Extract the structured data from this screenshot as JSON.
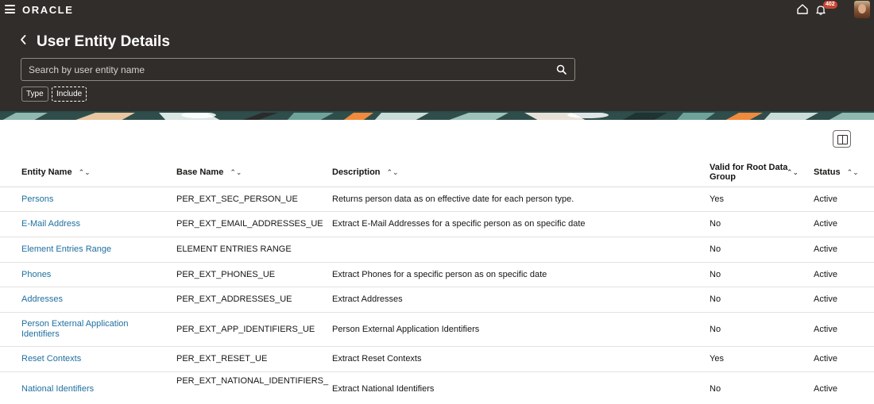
{
  "topbar": {
    "brand": "ORACLE",
    "notification_count": "402"
  },
  "header": {
    "title": "User Entity Details"
  },
  "search": {
    "placeholder": "Search by user entity name",
    "value": ""
  },
  "filters": {
    "type_label": "Type",
    "include_label": "Include"
  },
  "table": {
    "columns": [
      "Entity Name",
      "Base Name",
      "Description",
      "Valid for Root Data Group",
      "Status"
    ],
    "rows": [
      {
        "entity": "Persons",
        "base": "PER_EXT_SEC_PERSON_UE",
        "description": "Returns person data as on effective date for each person type.",
        "valid_root": "Yes",
        "status": "Active"
      },
      {
        "entity": "E-Mail Address",
        "base": "PER_EXT_EMAIL_ADDRESSES_UE",
        "description": "Extract E-Mail Addresses for a specific person as on specific date",
        "valid_root": "No",
        "status": "Active"
      },
      {
        "entity": "Element Entries Range",
        "base": "ELEMENT ENTRIES RANGE",
        "description": "",
        "valid_root": "No",
        "status": "Active"
      },
      {
        "entity": "Phones",
        "base": "PER_EXT_PHONES_UE",
        "description": "Extract Phones for a specific person as on specific date",
        "valid_root": "No",
        "status": "Active"
      },
      {
        "entity": "Addresses",
        "base": "PER_EXT_ADDRESSES_UE",
        "description": "Extract Addresses",
        "valid_root": "No",
        "status": "Active"
      },
      {
        "entity": "Person External Application Identifiers",
        "base": "PER_EXT_APP_IDENTIFIERS_UE",
        "description": "Person External Application Identifiers",
        "valid_root": "No",
        "status": "Active"
      },
      {
        "entity": "Reset Contexts",
        "base": "PER_EXT_RESET_UE",
        "description": "Extract Reset Contexts",
        "valid_root": "Yes",
        "status": "Active"
      },
      {
        "entity": "National Identifiers",
        "base": "PER_EXT_NATIONAL_IDENTIFIERS_",
        "description": "Extract National Identifiers",
        "valid_root": "No",
        "status": "Active"
      }
    ]
  },
  "icons": {
    "menu": "hamburger-menu-icon",
    "home": "home-icon",
    "notifications": "bell-icon",
    "back": "chevron-left-icon",
    "search": "search-icon",
    "columns": "column-view-icon",
    "sort": "sort-icon"
  },
  "colors": {
    "header_bg": "#312d2a",
    "link": "#1f6f9f",
    "badge": "#c74634"
  }
}
